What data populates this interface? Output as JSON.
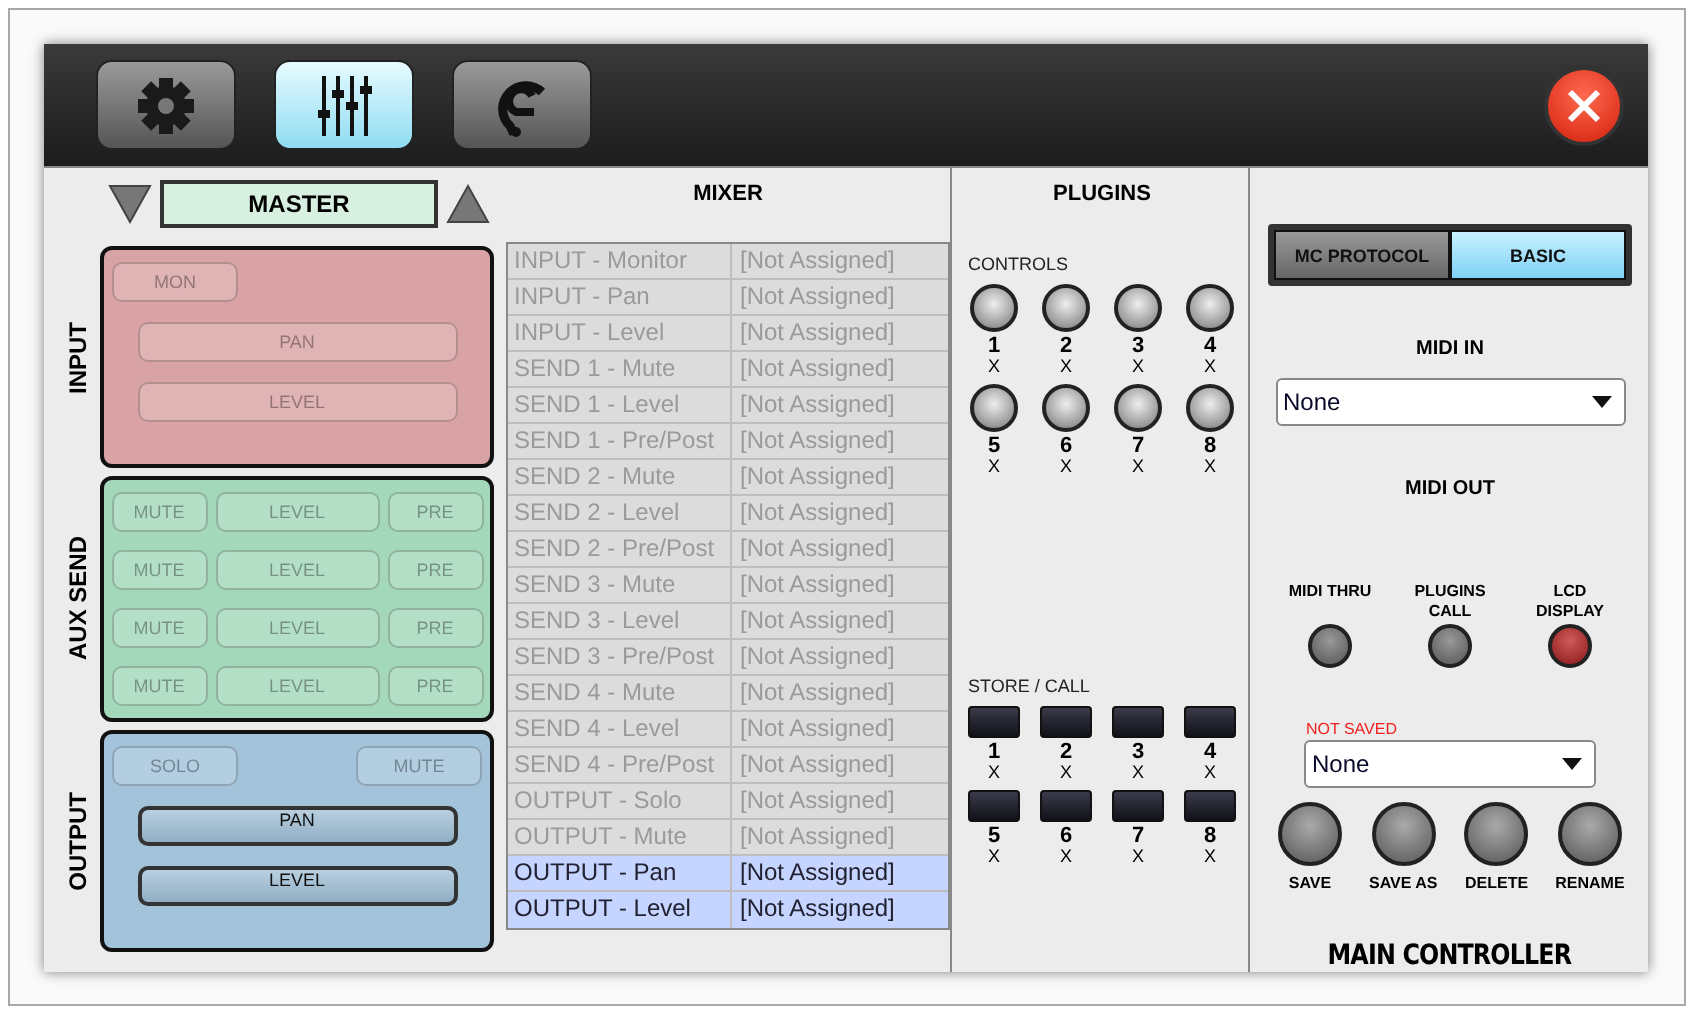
{
  "toolbar": {
    "tabs": [
      {
        "kind": "settings",
        "selected": false
      },
      {
        "kind": "mixer",
        "selected": true
      },
      {
        "kind": "ear",
        "selected": false
      }
    ]
  },
  "mixer": {
    "bus": "MASTER",
    "title": "MIXER",
    "strips": [
      {
        "kind": "input",
        "label": "INPUT",
        "buttons": [
          {
            "label": "MON",
            "active": false
          },
          {
            "label": "PAN",
            "active": false
          },
          {
            "label": "LEVEL",
            "active": false
          }
        ]
      },
      {
        "kind": "aux",
        "label": "AUX SEND",
        "buttons": [
          {
            "label": "MUTE",
            "active": false
          },
          {
            "label": "LEVEL",
            "active": false
          },
          {
            "label": "PRE",
            "active": false
          },
          {
            "label": "MUTE",
            "active": false
          },
          {
            "label": "LEVEL",
            "active": false
          },
          {
            "label": "PRE",
            "active": false
          },
          {
            "label": "MUTE",
            "active": false
          },
          {
            "label": "LEVEL",
            "active": false
          },
          {
            "label": "PRE",
            "active": false
          },
          {
            "label": "MUTE",
            "active": false
          },
          {
            "label": "LEVEL",
            "active": false
          },
          {
            "label": "PRE",
            "active": false
          }
        ]
      },
      {
        "kind": "output",
        "label": "OUTPUT",
        "buttons": [
          {
            "label": "SOLO",
            "active": false
          },
          {
            "label": "MUTE",
            "active": false
          },
          {
            "label": "PAN",
            "active": true
          },
          {
            "label": "LEVEL",
            "active": true
          }
        ]
      }
    ],
    "assignments": [
      {
        "control": "INPUT - Monitor",
        "assignment": "[Not Assigned]",
        "selected": false
      },
      {
        "control": "INPUT - Pan",
        "assignment": "[Not Assigned]",
        "selected": false
      },
      {
        "control": "INPUT - Level",
        "assignment": "[Not Assigned]",
        "selected": false
      },
      {
        "control": "SEND 1 - Mute",
        "assignment": "[Not Assigned]",
        "selected": false
      },
      {
        "control": "SEND 1 - Level",
        "assignment": "[Not Assigned]",
        "selected": false
      },
      {
        "control": "SEND 1 - Pre/Post",
        "assignment": "[Not Assigned]",
        "selected": false
      },
      {
        "control": "SEND 2 - Mute",
        "assignment": "[Not Assigned]",
        "selected": false
      },
      {
        "control": "SEND 2 - Level",
        "assignment": "[Not Assigned]",
        "selected": false
      },
      {
        "control": "SEND 2 - Pre/Post",
        "assignment": "[Not Assigned]",
        "selected": false
      },
      {
        "control": "SEND 3 - Mute",
        "assignment": "[Not Assigned]",
        "selected": false
      },
      {
        "control": "SEND 3 - Level",
        "assignment": "[Not Assigned]",
        "selected": false
      },
      {
        "control": "SEND 3 - Pre/Post",
        "assignment": "[Not Assigned]",
        "selected": false
      },
      {
        "control": "SEND 4 - Mute",
        "assignment": "[Not Assigned]",
        "selected": false
      },
      {
        "control": "SEND 4 - Level",
        "assignment": "[Not Assigned]",
        "selected": false
      },
      {
        "control": "SEND 4 - Pre/Post",
        "assignment": "[Not Assigned]",
        "selected": false
      },
      {
        "control": "OUTPUT - Solo",
        "assignment": "[Not Assigned]",
        "selected": false
      },
      {
        "control": "OUTPUT - Mute",
        "assignment": "[Not Assigned]",
        "selected": false
      },
      {
        "control": "OUTPUT - Pan",
        "assignment": "[Not Assigned]",
        "selected": true
      },
      {
        "control": "OUTPUT - Level",
        "assignment": "[Not Assigned]",
        "selected": true
      }
    ]
  },
  "plugins": {
    "title": "PLUGINS",
    "controls_label": "CONTROLS",
    "controls": [
      {
        "number": "1",
        "label": "X"
      },
      {
        "number": "2",
        "label": "X"
      },
      {
        "number": "3",
        "label": "X"
      },
      {
        "number": "4",
        "label": "X"
      },
      {
        "number": "5",
        "label": "X"
      },
      {
        "number": "6",
        "label": "X"
      },
      {
        "number": "7",
        "label": "X"
      },
      {
        "number": "8",
        "label": "X"
      }
    ],
    "store_label": "STORE / CALL",
    "slots": [
      {
        "number": "1",
        "label": "X"
      },
      {
        "number": "2",
        "label": "X"
      },
      {
        "number": "3",
        "label": "X"
      },
      {
        "number": "4",
        "label": "X"
      },
      {
        "number": "5",
        "label": "X"
      },
      {
        "number": "6",
        "label": "X"
      },
      {
        "number": "7",
        "label": "X"
      },
      {
        "number": "8",
        "label": "X"
      }
    ]
  },
  "main_controller": {
    "modes": [
      {
        "label": "MC PROTOCOL",
        "selected": false
      },
      {
        "label": "BASIC",
        "selected": true
      }
    ],
    "midi_in_label": "MIDI IN",
    "midi_in": "None",
    "midi_out_label": "MIDI OUT",
    "indicators": [
      {
        "label": "MIDI THRU",
        "on": false
      },
      {
        "label": "PLUGINS CALL",
        "on": false
      },
      {
        "label": "LCD DISPLAY",
        "on": true
      }
    ],
    "preset_status": "NOT SAVED",
    "preset": "None",
    "actions": [
      "SAVE",
      "SAVE AS",
      "DELETE",
      "RENAME"
    ],
    "title": "MAIN CONTROLLER"
  }
}
